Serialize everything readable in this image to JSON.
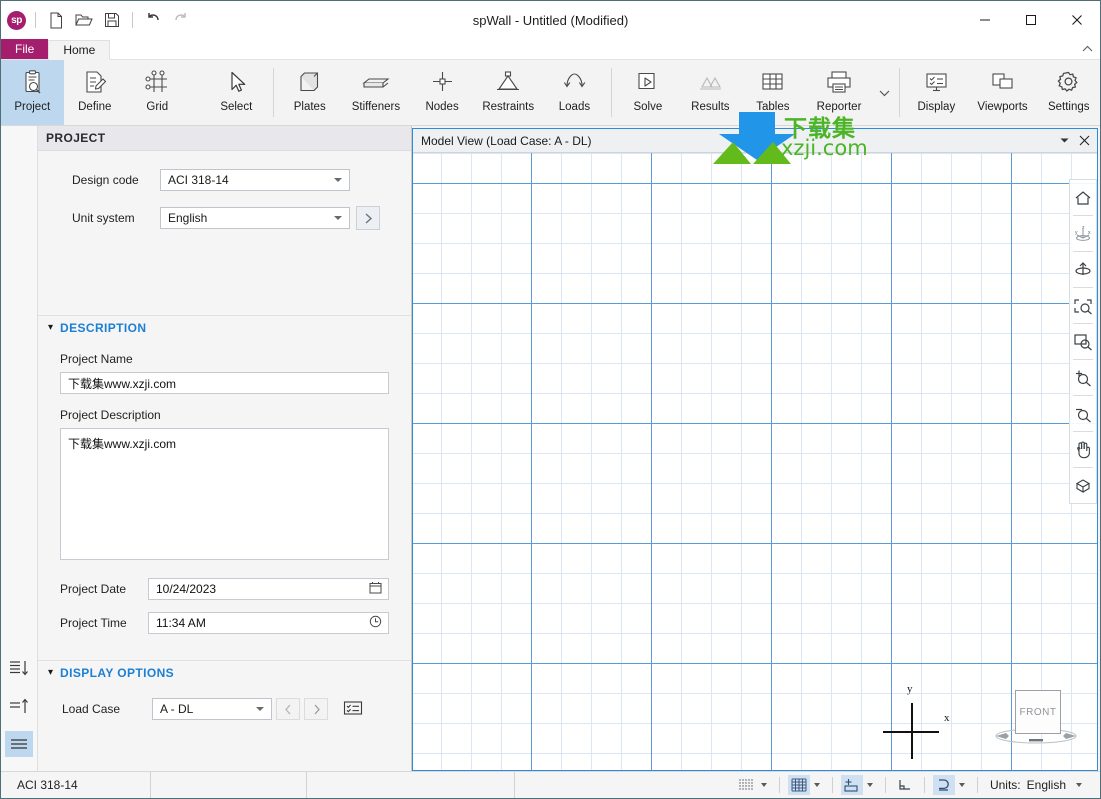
{
  "window": {
    "title": "spWall - Untitled (Modified)",
    "logo_text": "sp",
    "minimize": "minimize-button",
    "maximize": "maximize-button",
    "close": "close-button"
  },
  "quick_access": {
    "items": [
      {
        "name": "new-file-icon",
        "label": "New"
      },
      {
        "name": "open-file-icon",
        "label": "Open"
      },
      {
        "name": "save-file-icon",
        "label": "Save"
      },
      {
        "name": "undo-icon",
        "label": "Undo"
      },
      {
        "name": "redo-icon",
        "label": "Redo"
      }
    ]
  },
  "tabs": [
    {
      "label": "File",
      "name": "tab-file"
    },
    {
      "label": "Home",
      "name": "tab-home"
    }
  ],
  "ribbon": {
    "items": [
      {
        "label": "Project",
        "icon": "project-icon",
        "state": "selected"
      },
      {
        "label": "Define",
        "icon": "define-icon",
        "state": "normal"
      },
      {
        "label": "Grid",
        "icon": "grid-icon",
        "state": "normal"
      },
      {
        "label": "Select",
        "icon": "select-cursor-icon",
        "state": "normal"
      },
      {
        "label": "Plates",
        "icon": "plates-icon",
        "state": "normal"
      },
      {
        "label": "Stiffeners",
        "icon": "stiffeners-icon",
        "state": "normal"
      },
      {
        "label": "Nodes",
        "icon": "nodes-icon",
        "state": "normal"
      },
      {
        "label": "Restraints",
        "icon": "restraints-icon",
        "state": "normal"
      },
      {
        "label": "Loads",
        "icon": "loads-icon",
        "state": "normal"
      },
      {
        "label": "Solve",
        "icon": "solve-icon",
        "state": "normal"
      },
      {
        "label": "Results",
        "icon": "results-icon",
        "state": "disabled"
      },
      {
        "label": "Tables",
        "icon": "tables-icon",
        "state": "normal"
      },
      {
        "label": "Reporter",
        "icon": "reporter-icon",
        "state": "normal"
      },
      {
        "label": "Display",
        "icon": "display-icon",
        "state": "normal"
      },
      {
        "label": "Viewports",
        "icon": "viewports-icon",
        "state": "normal"
      },
      {
        "label": "Settings",
        "icon": "settings-gear-icon",
        "state": "normal"
      }
    ]
  },
  "watermark": {
    "chinese": "下载集",
    "english": "xzji.com",
    "color": "#4cb527"
  },
  "sidebar": {
    "title": "PROJECT",
    "design_code": {
      "label": "Design code",
      "value": "ACI 318-14"
    },
    "unit_system": {
      "label": "Unit system",
      "value": "English"
    },
    "description": {
      "header": "DESCRIPTION",
      "project_name_label": "Project Name",
      "project_name_value": "下载集www.xzji.com",
      "project_description_label": "Project Description",
      "project_description_value": "下载集www.xzji.com",
      "project_date_label": "Project Date",
      "project_date_value": "10/24/2023",
      "project_time_label": "Project Time",
      "project_time_value": "11:34 AM"
    },
    "display_options": {
      "header": "DISPLAY OPTIONS",
      "load_case_label": "Load Case",
      "load_case_value": "A - DL"
    },
    "strip_buttons": [
      {
        "name": "sort-descending-icon"
      },
      {
        "name": "sort-ascending-icon"
      },
      {
        "name": "list-view-icon"
      }
    ]
  },
  "model_view": {
    "header": "Model View (Load Case: A - DL)",
    "axis_x": "x",
    "axis_y": "y",
    "view_cube_label": "FRONT",
    "toolbar": [
      {
        "name": "home-view-icon"
      },
      {
        "name": "axes-orientation-icon"
      },
      {
        "name": "rotate-view-icon"
      },
      {
        "name": "zoom-extents-icon"
      },
      {
        "name": "zoom-window-icon"
      },
      {
        "name": "zoom-in-icon"
      },
      {
        "name": "zoom-out-icon"
      },
      {
        "name": "pan-hand-icon"
      },
      {
        "name": "iso-view-icon"
      }
    ]
  },
  "statusbar": {
    "code": "ACI 318-14",
    "cell2": "",
    "cell3": "",
    "tools": [
      {
        "name": "dot-grid-toggle",
        "on": false,
        "caret": true
      },
      {
        "name": "grid-toggle",
        "on": true,
        "caret": true
      },
      {
        "name": "snap-toggle",
        "on": true,
        "caret": true
      },
      {
        "name": "ortho-toggle",
        "on": false,
        "caret": false
      },
      {
        "name": "polar-toggle",
        "on": true,
        "caret": true
      }
    ],
    "units_label": "Units:",
    "units_value": "English"
  }
}
